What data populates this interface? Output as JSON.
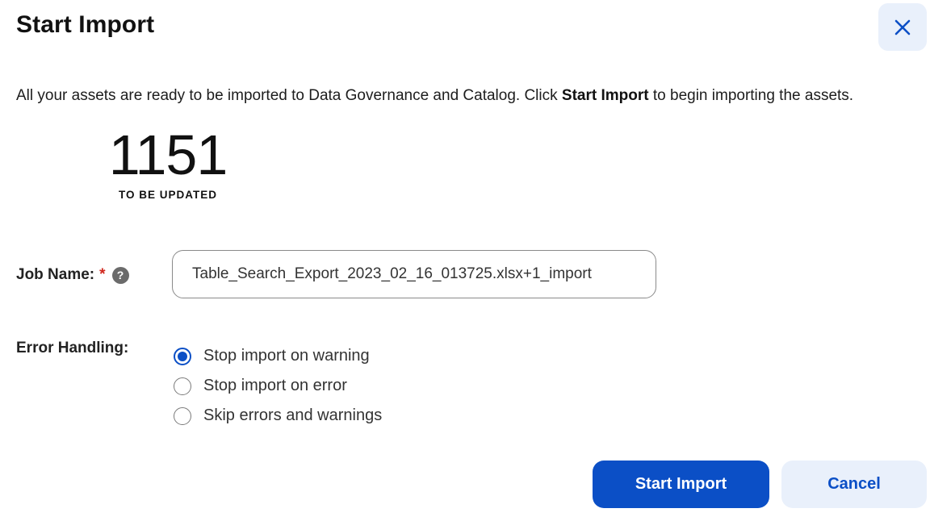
{
  "dialog": {
    "title": "Start Import",
    "close_icon": "close-icon"
  },
  "intro": {
    "text_before": "All your assets are ready to be imported to Data Governance and Catalog. Click ",
    "text_bold": "Start Import",
    "text_after": " to begin importing the assets."
  },
  "stat": {
    "value": "1151",
    "label": "TO BE UPDATED"
  },
  "job_name": {
    "label": "Job Name:",
    "required_marker": "*",
    "help_icon": "?",
    "value": "Table_Search_Export_2023_02_16_013725.xlsx+1_import"
  },
  "error_handling": {
    "label": "Error Handling:",
    "options": [
      {
        "label": "Stop import on warning",
        "selected": true
      },
      {
        "label": "Stop import on error",
        "selected": false
      },
      {
        "label": "Skip errors and warnings",
        "selected": false
      }
    ]
  },
  "actions": {
    "start_label": "Start Import",
    "cancel_label": "Cancel"
  },
  "colors": {
    "accent": "#0b4fc6",
    "secondary_bg": "#e9f0fb",
    "required": "#d0271d"
  }
}
